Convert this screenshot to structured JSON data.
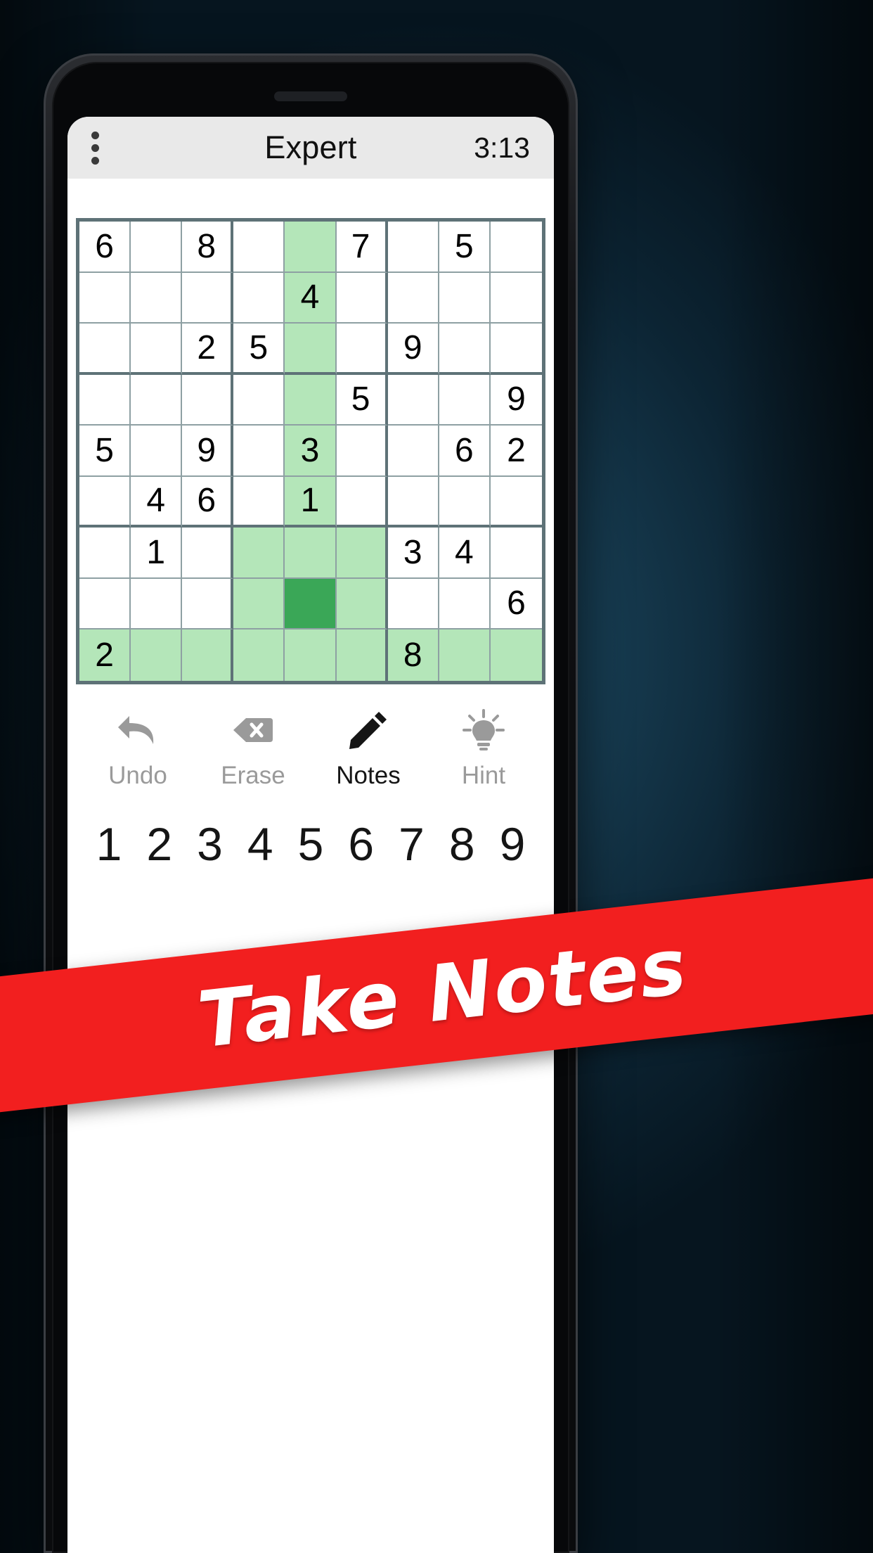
{
  "app": {
    "title": "Expert",
    "timer": "3:13",
    "menu_icon": "overflow-menu-icon"
  },
  "board": {
    "rows": [
      [
        "6",
        "",
        "8",
        "",
        "",
        "7",
        "",
        "5",
        ""
      ],
      [
        "",
        "",
        "",
        "",
        "4",
        "",
        "",
        "",
        ""
      ],
      [
        "",
        "",
        "2",
        "5",
        "",
        "",
        "9",
        "",
        ""
      ],
      [
        "",
        "",
        "",
        "",
        "",
        "5",
        "",
        "",
        "9"
      ],
      [
        "5",
        "",
        "9",
        "",
        "3",
        "",
        "",
        "6",
        "2"
      ],
      [
        "",
        "4",
        "6",
        "",
        "1",
        "",
        "",
        "",
        ""
      ],
      [
        "",
        "1",
        "",
        "",
        "",
        "",
        "3",
        "4",
        ""
      ],
      [
        "",
        "",
        "",
        "",
        "",
        "",
        "",
        "",
        "6"
      ],
      [
        "2",
        "",
        "",
        "",
        "",
        "",
        "8",
        "",
        ""
      ]
    ],
    "highlighted_cells": [
      [
        0,
        4
      ],
      [
        1,
        4
      ],
      [
        2,
        4
      ],
      [
        3,
        4
      ],
      [
        4,
        4
      ],
      [
        5,
        4
      ],
      [
        6,
        3
      ],
      [
        6,
        4
      ],
      [
        6,
        5
      ],
      [
        7,
        3
      ],
      [
        7,
        5
      ],
      [
        8,
        0
      ],
      [
        8,
        1
      ],
      [
        8,
        2
      ],
      [
        8,
        3
      ],
      [
        8,
        4
      ],
      [
        8,
        5
      ],
      [
        8,
        6
      ],
      [
        8,
        7
      ],
      [
        8,
        8
      ]
    ],
    "selected_cell": [
      7,
      4
    ],
    "colors": {
      "highlight": "#b4e6b9",
      "selected": "#3aa757",
      "grid_line_thick": "#5e7277",
      "grid_line_thin": "#8ea0a3"
    }
  },
  "actions": [
    {
      "label": "Undo",
      "icon": "undo-arrow-icon",
      "state": "dim"
    },
    {
      "label": "Erase",
      "icon": "eraser-icon",
      "state": "dim"
    },
    {
      "label": "Notes",
      "icon": "pencil-icon",
      "state": "on"
    },
    {
      "label": "Hint",
      "icon": "lightbulb-icon",
      "state": "dim"
    }
  ],
  "numpad": [
    "1",
    "2",
    "3",
    "4",
    "5",
    "6",
    "7",
    "8",
    "9"
  ],
  "banner": {
    "text": "Take Notes",
    "color": "#f21f1f"
  }
}
